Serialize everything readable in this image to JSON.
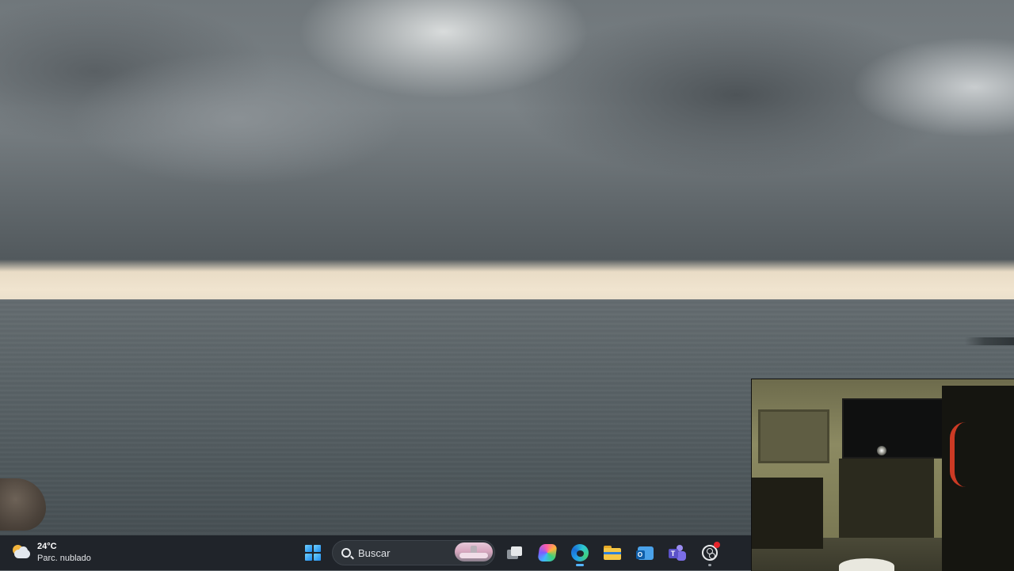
{
  "wallpaper": {
    "description_colors": {
      "sky": "#70777b",
      "horizon": "#f0e4cf",
      "sea": "#4e575b"
    }
  },
  "taskbar": {
    "weather": {
      "temperature": "24°C",
      "condition": "Parc. nublado",
      "icon": "partly-cloudy-icon"
    },
    "start_icon": "windows-start-icon",
    "search": {
      "placeholder": "Buscar",
      "icon": "search-icon"
    },
    "pinned_apps": [
      {
        "name": "task-view",
        "icon": "task-view-icon"
      },
      {
        "name": "copilot",
        "icon": "copilot-icon"
      },
      {
        "name": "microsoft-edge",
        "icon": "edge-icon",
        "state": "active"
      },
      {
        "name": "file-explorer",
        "icon": "folder-icon"
      },
      {
        "name": "outlook",
        "icon": "outlook-icon"
      },
      {
        "name": "teams",
        "icon": "teams-icon"
      },
      {
        "name": "obs-studio",
        "icon": "obs-icon",
        "state": "recording"
      }
    ],
    "accent_color": "#55b4ff",
    "background_color": "#20242a"
  },
  "camera_preview": {
    "type": "webcam-overlay"
  }
}
